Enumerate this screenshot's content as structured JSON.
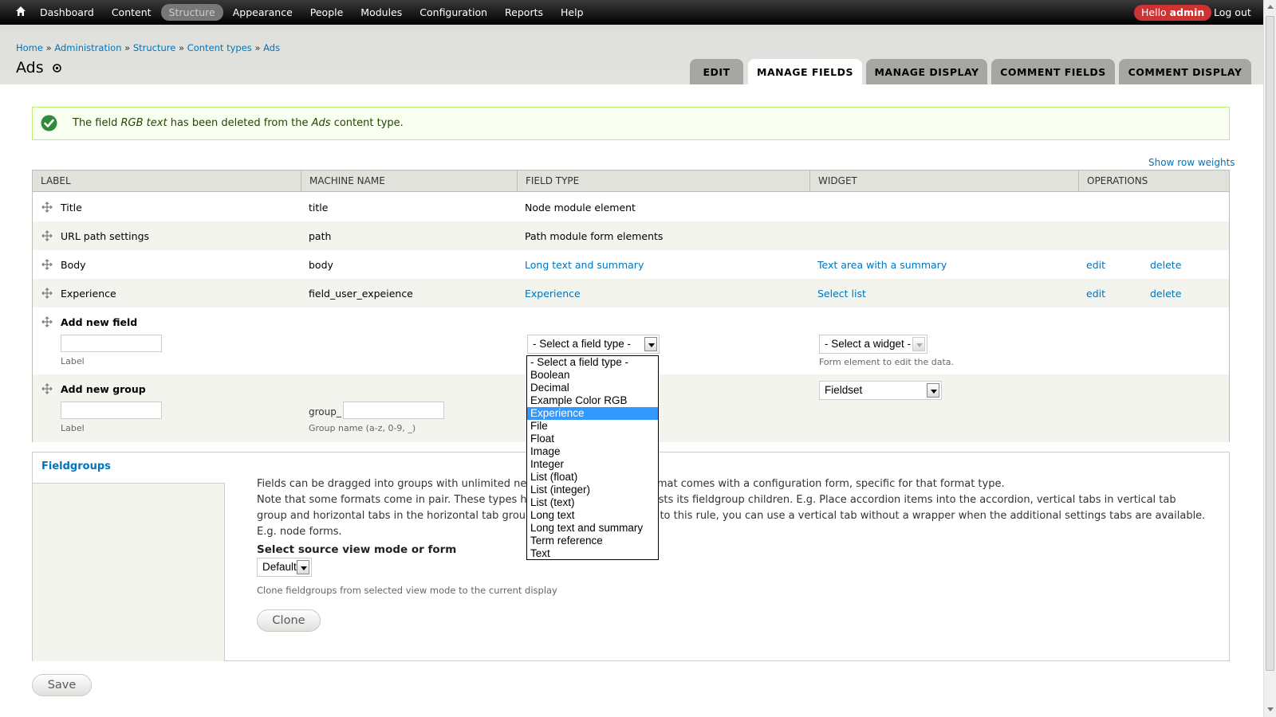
{
  "toolbar": {
    "menu": [
      "Dashboard",
      "Content",
      "Structure",
      "Appearance",
      "People",
      "Modules",
      "Configuration",
      "Reports",
      "Help"
    ],
    "active": "Structure",
    "hello_prefix": "Hello",
    "hello_user": "admin",
    "logout": "Log out"
  },
  "breadcrumb": {
    "items": [
      "Home",
      "Administration",
      "Structure",
      "Content types",
      "Ads"
    ],
    "separator": "»"
  },
  "page": {
    "title": "Ads"
  },
  "tabs": [
    "EDIT",
    "MANAGE FIELDS",
    "MANAGE DISPLAY",
    "COMMENT FIELDS",
    "COMMENT DISPLAY"
  ],
  "active_tab": "MANAGE FIELDS",
  "status": {
    "pre": "The field",
    "field": "RGB text",
    "mid": "has been deleted from the",
    "type": "Ads",
    "post": "content type."
  },
  "show_row_weights": "Show row weights",
  "table": {
    "headers": [
      "LABEL",
      "MACHINE NAME",
      "FIELD TYPE",
      "WIDGET",
      "OPERATIONS"
    ],
    "rows": [
      {
        "label": "Title",
        "machine": "title",
        "type": "Node module element",
        "widget": "",
        "edit": "",
        "delete": ""
      },
      {
        "label": "URL path settings",
        "machine": "path",
        "type": "Path module form elements",
        "widget": "",
        "edit": "",
        "delete": ""
      },
      {
        "label": "Body",
        "machine": "body",
        "type": "Long text and summary",
        "widget": "Text area with a summary",
        "edit": "edit",
        "delete": "delete"
      },
      {
        "label": "Experience",
        "machine": "field_user_expeience",
        "type": "Experience",
        "widget": "Select list",
        "edit": "edit",
        "delete": "delete"
      }
    ],
    "add_field": {
      "title": "Add new field",
      "label_desc": "Label",
      "type_select": "- Select a field type -",
      "widget_select": "- Select a widget -",
      "widget_desc": "Form element to edit the data."
    },
    "add_group": {
      "title": "Add new group",
      "label_desc": "Label",
      "prefix": "group_",
      "name_desc": "Group name (a-z, 0-9, _)",
      "widget_select": "Fieldset"
    }
  },
  "dropdown": {
    "options": [
      "- Select a field type -",
      "Boolean",
      "Decimal",
      "Example Color RGB",
      "Experience",
      "File",
      "Float",
      "Image",
      "Integer",
      "List (float)",
      "List (integer)",
      "List (text)",
      "Long text",
      "Long text and summary",
      "Term reference",
      "Text"
    ],
    "selected": "Experience"
  },
  "fieldgroups": {
    "title": "Fieldgroups",
    "line1": "Fields can be dragged into groups with unlimited nesting. Each fieldgroup format comes with a configuration form, specific for that format type.",
    "line2": "Note that some formats come in pair. These types have a html wrapper to nests its fieldgroup children. E.g. Place accordion items into the accordion, vertical tabs in vertical tab group and horizontal tabs in the horizontal tab group. There is one exception to this rule, you can use a vertical tab without a wrapper when the additional settings tabs are available. E.g. node forms.",
    "select_label": "Select source view mode or form",
    "select_value": "Default",
    "clone_desc": "Clone fieldgroups from selected view mode to the current display",
    "clone_button": "Clone"
  },
  "save_button": "Save",
  "colors": {
    "link": "#0074bd",
    "status_bg": "#f8fff0",
    "status_border": "#bbee77",
    "hello_bg": "#cc3333",
    "selected_option": "#3399ff"
  }
}
